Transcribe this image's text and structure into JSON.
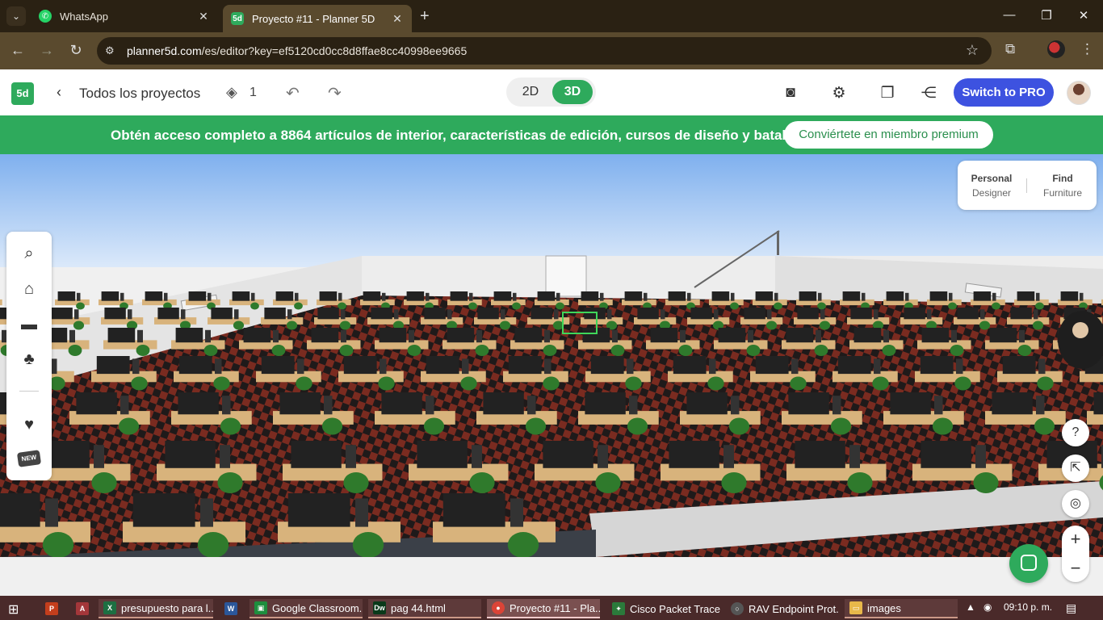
{
  "browser": {
    "tabs": [
      {
        "title": "WhatsApp",
        "active": false
      },
      {
        "title": "Proyecto #11 - Planner 5D",
        "active": true
      }
    ],
    "url_host": "planner5d.com",
    "url_path": "/es/editor?key=ef5120cd0cc8d8ffae8cc40998ee9665"
  },
  "app": {
    "logo": "5d",
    "back_label": "Todos los proyectos",
    "layers_count": "1",
    "view_2d": "2D",
    "view_3d": "3D",
    "pro_button": "Switch to PRO"
  },
  "banner": {
    "text": "Obtén acceso completo a 8864 artículos de interior, características de edición, cursos de diseño y batallas",
    "cta": "Conviértete en miembro premium"
  },
  "designer_panel": {
    "personal_line1": "Personal",
    "personal_line2": "Designer",
    "find_line1": "Find",
    "find_line2": "Furniture"
  },
  "side_toolbar": {
    "new_badge": "NEW"
  },
  "taskbar": {
    "apps": [
      {
        "label": "presupuesto para l...",
        "icon": "excel-icon",
        "color": "#1d6f42"
      },
      {
        "label": "Google Classroom...",
        "icon": "classroom-icon",
        "color": "#1e8e3e"
      },
      {
        "label": "pag 44.html",
        "icon": "dreamweaver-icon",
        "color": "#0a3a1a"
      },
      {
        "label": "Proyecto #11 - Pla...",
        "icon": "chrome-icon",
        "color": "#db4437"
      },
      {
        "label": "Cisco Packet Tracer",
        "icon": "packet-tracer-icon",
        "color": "#2b7a3b"
      },
      {
        "label": "RAV Endpoint Prot...",
        "icon": "rav-icon",
        "color": "#555555"
      },
      {
        "label": "images",
        "icon": "folder-icon",
        "color": "#e8b84a"
      }
    ],
    "clock": "09:10 p. m."
  },
  "colors": {
    "accent_green": "#2eaa5c",
    "pro_blue": "#3d52e0",
    "browser_dark": "#2a2113",
    "browser_toolbar": "#5a4a2e"
  }
}
